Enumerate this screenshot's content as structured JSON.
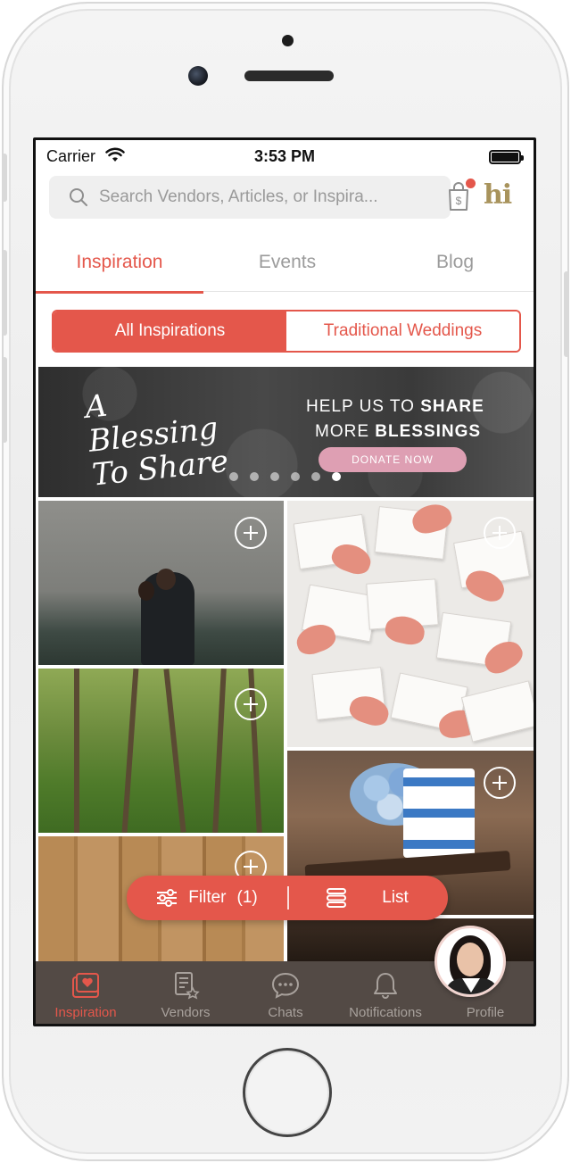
{
  "status_bar": {
    "carrier": "Carrier",
    "time": "3:53 PM"
  },
  "search": {
    "placeholder": "Search Vendors, Articles, or Inspira..."
  },
  "header": {
    "logo_text": "hi"
  },
  "tabs": [
    {
      "label": "Inspiration",
      "active": true
    },
    {
      "label": "Events",
      "active": false
    },
    {
      "label": "Blog",
      "active": false
    }
  ],
  "segments": [
    {
      "label": "All Inspirations",
      "active": true
    },
    {
      "label": "Traditional Weddings",
      "active": false
    }
  ],
  "banner": {
    "script_title": "A Blessing To Share",
    "line1_prefix": "HELP US TO ",
    "line1_bold": "SHARE",
    "line2_prefix": "MORE ",
    "line2_bold": "BLESSINGS",
    "button": "DONATE NOW",
    "slide_count": 6,
    "active_slide": 6
  },
  "filter_bar": {
    "filter_label": "Filter",
    "filter_count": "(1)",
    "list_label": "List"
  },
  "bottom_nav": [
    {
      "label": "Inspiration",
      "icon": "inspiration-icon",
      "active": true
    },
    {
      "label": "Vendors",
      "icon": "vendors-icon",
      "active": false
    },
    {
      "label": "Chats",
      "icon": "chats-icon",
      "active": false
    },
    {
      "label": "Notifications",
      "icon": "bell-icon",
      "active": false
    },
    {
      "label": "Profile",
      "icon": "profile-icon",
      "active": false
    }
  ],
  "colors": {
    "accent": "#e4574b",
    "nav_bg": "#534a45",
    "logo": "#a8935c"
  }
}
